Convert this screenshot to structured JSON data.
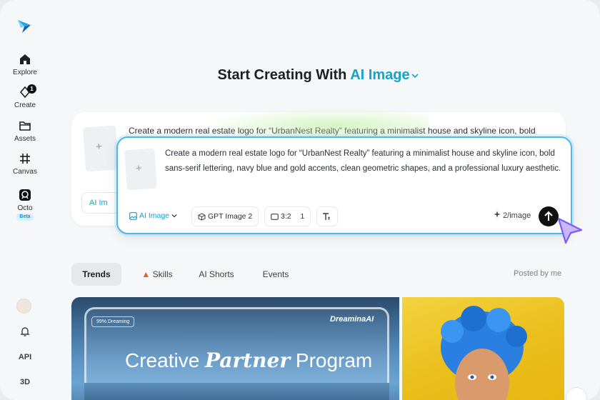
{
  "sidebar": {
    "items": [
      {
        "label": "Explore",
        "icon": "home-icon"
      },
      {
        "label": "Create",
        "icon": "sparkle-pen-icon",
        "badge": "1"
      },
      {
        "label": "Assets",
        "icon": "folder-icon"
      },
      {
        "label": "Canvas",
        "icon": "grid-frame-icon"
      },
      {
        "label": "Octo",
        "icon": "octo-icon",
        "tag": "Beta"
      }
    ],
    "bottom": {
      "bell_icon": "bell-icon",
      "api": "API",
      "three_d": "3D"
    }
  },
  "headline": {
    "prefix": "Start Creating With",
    "mode": "AI Image"
  },
  "back_card": {
    "text": "Create a modern real estate logo for “UrbanNest Realty” featuring a minimalist house and skyline icon, bold",
    "chip_label": "AI Im"
  },
  "prompt": {
    "text": "Create a modern real estate logo for “UrbanNest Realty” featuring a minimalist house and skyline icon, bold sans-serif lettering, navy blue and gold accents, clean geometric shapes, and a professional luxury aesthetic.",
    "mode_chip": "AI Image",
    "model_chip": "GPT Image 2",
    "ratio": "3:2",
    "count": "1",
    "cost": "2/image"
  },
  "tabs": {
    "items": [
      {
        "label": "Trends",
        "active": true
      },
      {
        "label": "Skills",
        "icon": "fire-icon"
      },
      {
        "label": "AI Shorts"
      },
      {
        "label": "Events"
      }
    ],
    "posted_by": "Posted by me"
  },
  "banner": {
    "tag": "99% Dreaming",
    "brand": "DreaminaAI",
    "title_a": "Creative",
    "title_b": "Partner",
    "title_c": "Program"
  },
  "colors": {
    "accent": "#17a3c8",
    "border": "#4fb6e8",
    "background": "#f6f7f9"
  }
}
